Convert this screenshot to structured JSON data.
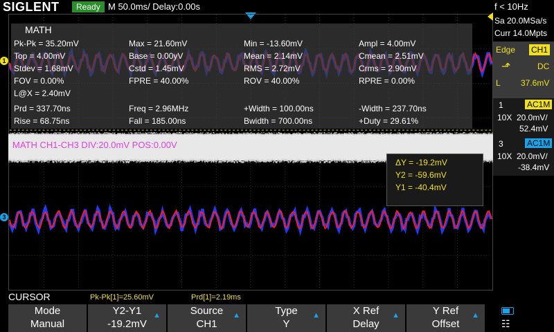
{
  "header": {
    "brand": "SIGLENT",
    "status": "Ready",
    "timebase": "M 50.0ms/ Delay:0.00s",
    "frequency": "f < 10Hz"
  },
  "acquisition": {
    "sample_rate": "Sa 20.0MSa/s",
    "current_points": "Curr 14.0Mpts"
  },
  "trigger": {
    "mode_label": "Edge",
    "source": "CH1",
    "coupling": "DC",
    "level_label": "L",
    "level": "37.6mV"
  },
  "channels": [
    {
      "id": "1",
      "coupling": "AC1M",
      "probe": "10X",
      "scale": "20.0mV/",
      "offset": "52.4mV",
      "color": "#f0e020"
    },
    {
      "id": "3",
      "coupling": "AC1M",
      "probe": "10X",
      "scale": "20.0mV/",
      "offset": "-38.4mV",
      "color": "#1aa3e8"
    }
  ],
  "math_panel": {
    "title": "MATH",
    "rows": [
      [
        "Pk-Pk = 35.20mV",
        "Max = 21.60mV",
        "Min = -13.60mV",
        "Ampl = 4.00mV"
      ],
      [
        "Top = 4.00mV",
        "Base = 0.00yV",
        "Mean = 2.14mV",
        "Cmean = 2.51mV"
      ],
      [
        "Stdev = 1.68mV",
        "Cstd = 1.45mV",
        "RMS = 2.72mV",
        "Crms = 2.90mV"
      ],
      [
        "FOV = 0.00%",
        "FPRE = 40.00%",
        "ROV = 40.00%",
        "RPRE = 0.00%"
      ],
      [
        "L@X = 2.40mV",
        "",
        "",
        ""
      ],
      [
        "Prd = 337.70ns",
        "Freq = 2.96MHz",
        "+Width = 100.00ns",
        "-Width = 237.70ns"
      ],
      [
        "Rise = 68.75ns",
        "Fall = 185.00ns",
        "Bwidth = 700.00ns",
        "+Duty = 29.61%"
      ]
    ]
  },
  "math_trace": {
    "label": "MATH  CH1-CH3  DIV:20.0mV  POS:0.00V",
    "color": "#e040e0"
  },
  "cursor_readout": {
    "delta_y": "ΔY = -19.2mV",
    "y2": "Y2 = -59.6mV",
    "y1": "Y1 = -40.4mV"
  },
  "bottom": {
    "menu_title": "CURSOR",
    "measure_pkpk": "Pk-Pk[1]=25.60mV",
    "measure_prd": "Prd[1]=2.19ms",
    "softkeys": [
      {
        "top": "Mode",
        "bottom": "Manual",
        "arrow": false
      },
      {
        "top": "Y2-Y1",
        "bottom": "-19.2mV",
        "arrow": true
      },
      {
        "top": "Source",
        "bottom": "CH1",
        "arrow": true
      },
      {
        "top": "Type",
        "bottom": "Y",
        "arrow": true
      },
      {
        "top": "X Ref",
        "bottom": "Delay",
        "arrow": true
      },
      {
        "top": "Y Ref",
        "bottom": "Offset",
        "arrow": true
      }
    ]
  },
  "colors": {
    "ch1_trace": "#1a3cff",
    "ch3_trace": "#ff1a1a",
    "accent": "#1aa3e8",
    "math": "#e040e0"
  }
}
